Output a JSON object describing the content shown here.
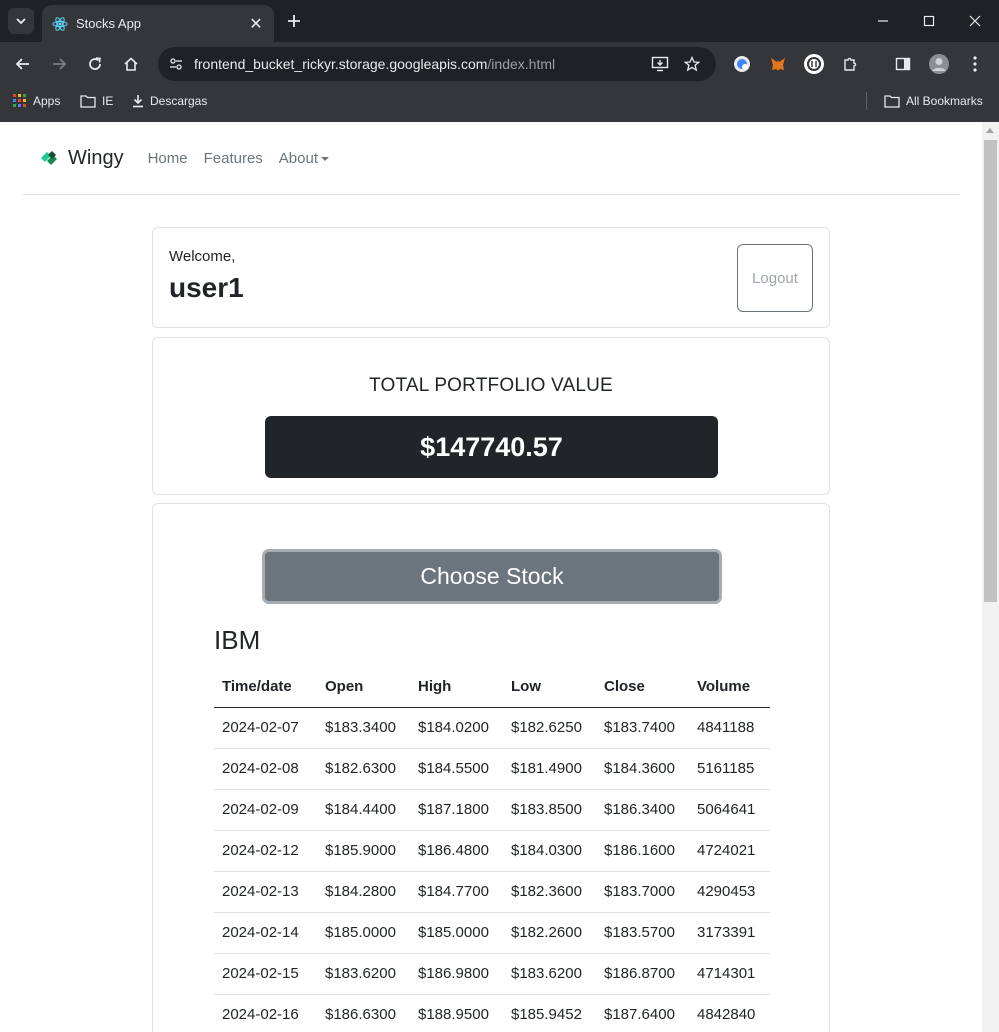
{
  "browser": {
    "tab_title": "Stocks App",
    "url_host": "frontend_bucket_rickyr.storage.googleapis.com",
    "url_path": "/index.html",
    "bookmarks": [
      {
        "label": "Apps"
      },
      {
        "label": "IE"
      },
      {
        "label": "Descargas"
      }
    ],
    "all_bookmarks": "All Bookmarks"
  },
  "nav": {
    "brand": "Wingy",
    "links": [
      "Home",
      "Features",
      "About"
    ]
  },
  "welcome": {
    "label": "Welcome,",
    "username": "user1",
    "logout_label": "Logout"
  },
  "portfolio": {
    "title": "TOTAL PORTFOLIO VALUE",
    "value": "$147740.57"
  },
  "stocks": {
    "choose_label": "Choose Stock",
    "symbol": "IBM",
    "columns": [
      "Time/date",
      "Open",
      "High",
      "Low",
      "Close",
      "Volume"
    ],
    "rows": [
      [
        "2024-02-07",
        "$183.3400",
        "$184.0200",
        "$182.6250",
        "$183.7400",
        "4841188"
      ],
      [
        "2024-02-08",
        "$182.6300",
        "$184.5500",
        "$181.4900",
        "$184.3600",
        "5161185"
      ],
      [
        "2024-02-09",
        "$184.4400",
        "$187.1800",
        "$183.8500",
        "$186.3400",
        "5064641"
      ],
      [
        "2024-02-12",
        "$185.9000",
        "$186.4800",
        "$184.0300",
        "$186.1600",
        "4724021"
      ],
      [
        "2024-02-13",
        "$184.2800",
        "$184.7700",
        "$182.3600",
        "$183.7000",
        "4290453"
      ],
      [
        "2024-02-14",
        "$185.0000",
        "$185.0000",
        "$182.2600",
        "$183.5700",
        "3173391"
      ],
      [
        "2024-02-15",
        "$183.6200",
        "$186.9800",
        "$183.6200",
        "$186.8700",
        "4714301"
      ],
      [
        "2024-02-16",
        "$186.6300",
        "$188.9500",
        "$185.9452",
        "$187.6400",
        "4842840"
      ]
    ]
  },
  "colors": {
    "chrome_dark": "#202124",
    "chrome_toolbar": "#35363a",
    "portfolio_bg": "#212529",
    "button_secondary": "#6c757d",
    "brand_green": "#20c997"
  }
}
